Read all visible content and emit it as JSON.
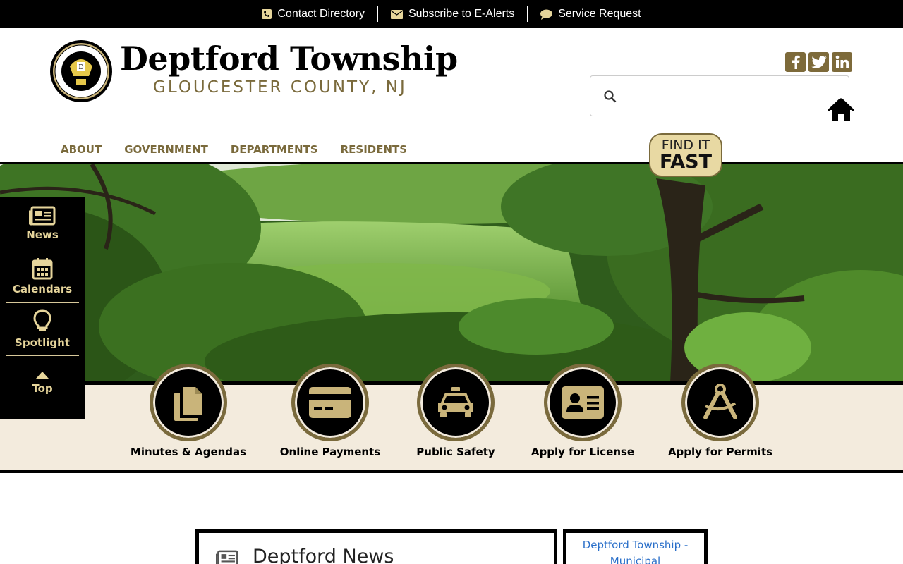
{
  "topbar": {
    "links": [
      {
        "label": "Contact Directory",
        "icon": "phone-icon"
      },
      {
        "label": "Subscribe to E-Alerts",
        "icon": "envelope-icon"
      },
      {
        "label": "Service Request",
        "icon": "chat-bubble-icon"
      }
    ]
  },
  "header": {
    "title": "Deptford Township",
    "subtitle": "GLOUCESTER COUNTY, NJ",
    "seal_icon": "township-seal-logo",
    "social": [
      "facebook-icon",
      "twitter-icon",
      "linkedin-icon"
    ],
    "search_placeholder": ""
  },
  "nav": {
    "items": [
      "ABOUT",
      "GOVERNMENT",
      "DEPARTMENTS",
      "RESIDENTS"
    ],
    "find_it_line1": "FIND IT",
    "find_it_line2": "FAST"
  },
  "sidebar": {
    "items": [
      {
        "label": "News",
        "icon": "newspaper-icon"
      },
      {
        "label": "Calendars",
        "icon": "calendar-icon"
      },
      {
        "label": "Spotlight",
        "icon": "lightbulb-icon"
      },
      {
        "label": "Top",
        "icon": "caret-up-icon"
      }
    ]
  },
  "quicklinks": [
    {
      "label": "Minutes & Agendas",
      "icon": "documents-icon"
    },
    {
      "label": "Online Payments",
      "icon": "credit-card-icon"
    },
    {
      "label": "Public Safety",
      "icon": "taxi-icon"
    },
    {
      "label": "Apply for License",
      "icon": "id-card-icon"
    },
    {
      "label": "Apply for Permits",
      "icon": "drafting-compass-icon"
    }
  ],
  "content": {
    "news_title": "Deptford News",
    "side_link_line1": "Deptford Township -",
    "side_link_line2": "Municipal"
  },
  "colors": {
    "gold": "#7a6a3c",
    "gold_light": "#e6d59b",
    "band_bg": "#f3ebdd",
    "black": "#000000"
  }
}
